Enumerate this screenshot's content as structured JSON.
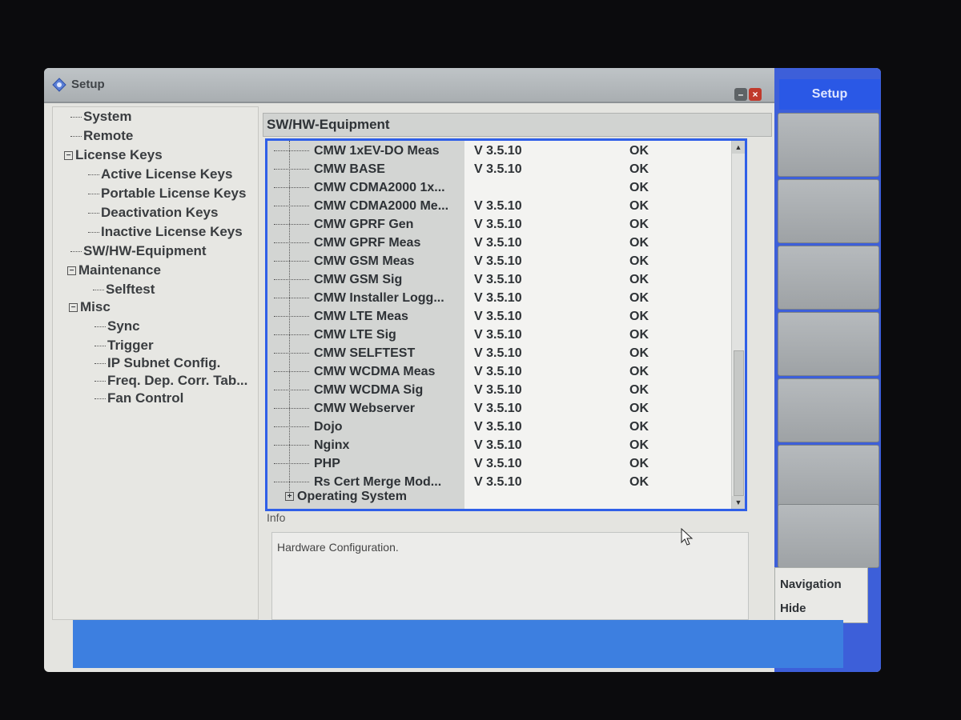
{
  "window": {
    "title": "Setup"
  },
  "softkeys": {
    "title": "Setup",
    "navigation_line1": "Navigation",
    "navigation_line2": "Hide"
  },
  "nav_tree": [
    {
      "label": "System",
      "type": "leaf",
      "level": 0
    },
    {
      "label": "Remote",
      "type": "leaf",
      "level": 0
    },
    {
      "label": "License Keys",
      "type": "expanded",
      "level": 0
    },
    {
      "label": "Active License Keys",
      "type": "leaf",
      "level": 1
    },
    {
      "label": "Portable License Keys",
      "type": "leaf",
      "level": 1
    },
    {
      "label": "Deactivation Keys",
      "type": "leaf",
      "level": 1
    },
    {
      "label": "Inactive License Keys",
      "type": "leaf",
      "level": 1
    },
    {
      "label": "SW/HW-Equipment",
      "type": "leaf",
      "level": 0
    },
    {
      "label": "Maintenance",
      "type": "expanded",
      "level": 0
    },
    {
      "label": "Selftest",
      "type": "leaf",
      "level": 1
    },
    {
      "label": "Misc",
      "type": "expanded",
      "level": 0
    },
    {
      "label": "Sync",
      "type": "leaf",
      "level": 1
    },
    {
      "label": "Trigger",
      "type": "leaf",
      "level": 1
    },
    {
      "label": "IP Subnet Config.",
      "type": "leaf",
      "level": 1
    },
    {
      "label": "Freq. Dep. Corr. Tab...",
      "type": "leaf",
      "level": 1
    },
    {
      "label": "Fan Control",
      "type": "leaf",
      "level": 1
    }
  ],
  "content": {
    "header": "SW/HW-Equipment",
    "rows": [
      {
        "name": "CMW 1xEV-DO Meas",
        "version": "V 3.5.10",
        "status": "OK"
      },
      {
        "name": "CMW BASE",
        "version": "V 3.5.10",
        "status": "OK"
      },
      {
        "name": "CMW CDMA2000 1x...",
        "version": "",
        "status": "OK"
      },
      {
        "name": "CMW CDMA2000 Me...",
        "version": "V 3.5.10",
        "status": "OK"
      },
      {
        "name": "CMW GPRF Gen",
        "version": "V 3.5.10",
        "status": "OK"
      },
      {
        "name": "CMW GPRF Meas",
        "version": "V 3.5.10",
        "status": "OK"
      },
      {
        "name": "CMW GSM Meas",
        "version": "V 3.5.10",
        "status": "OK"
      },
      {
        "name": "CMW GSM Sig",
        "version": "V 3.5.10",
        "status": "OK"
      },
      {
        "name": "CMW Installer Logg...",
        "version": "V 3.5.10",
        "status": "OK"
      },
      {
        "name": "CMW LTE Meas",
        "version": "V 3.5.10",
        "status": "OK"
      },
      {
        "name": "CMW LTE Sig",
        "version": "V 3.5.10",
        "status": "OK"
      },
      {
        "name": "CMW SELFTEST",
        "version": "V 3.5.10",
        "status": "OK"
      },
      {
        "name": "CMW WCDMA Meas",
        "version": "V 3.5.10",
        "status": "OK"
      },
      {
        "name": "CMW WCDMA Sig",
        "version": "V 3.5.10",
        "status": "OK"
      },
      {
        "name": "CMW Webserver",
        "version": "V 3.5.10",
        "status": "OK"
      },
      {
        "name": "Dojo",
        "version": "V 3.5.10",
        "status": "OK"
      },
      {
        "name": "Nginx",
        "version": "V 3.5.10",
        "status": "OK"
      },
      {
        "name": "PHP",
        "version": "V 3.5.10",
        "status": "OK"
      },
      {
        "name": "Rs Cert Merge Mod...",
        "version": "V 3.5.10",
        "status": "OK"
      }
    ],
    "collapsed_node": "Operating System"
  },
  "info": {
    "label": "Info",
    "text": "Hardware Configuration."
  },
  "colors": {
    "accent_blue": "#2f5fe8",
    "softkey_panel": "#3d5fd9",
    "status_bar": "#3d7fe0"
  }
}
